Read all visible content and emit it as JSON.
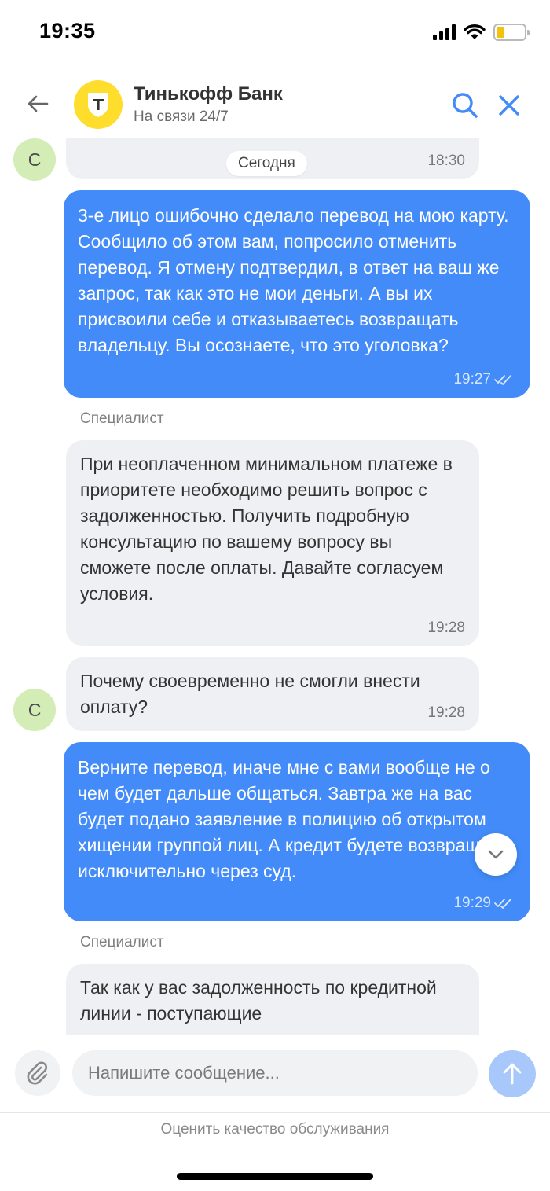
{
  "status_bar": {
    "time": "19:35",
    "icons": [
      "signal-icon",
      "wifi-icon",
      "battery-icon"
    ],
    "battery_color": "#f4c20d"
  },
  "header": {
    "title": "Тинькофф Банк",
    "subtitle": "На связи 24/7",
    "logo_letter": "т",
    "accent_color": "#428bf9"
  },
  "chat": {
    "avatar_letter": "С",
    "sender_label": "Специалист",
    "date_chip": "Сегодня",
    "messages": [
      {
        "direction": "incoming",
        "text": "",
        "time": "18:30"
      },
      {
        "direction": "outgoing",
        "text": "3-е лицо ошибочно сделало перевод на мою карту. Сообщило об этом вам, попросило отменить перевод. Я отмену подтвердил, в ответ на ваш же запрос, так как это не мои деньги. А вы их присвоили себе и отказываетесь возвращать владельцу. Вы осознаете, что это уголовка?",
        "time": "19:27",
        "status": "read"
      },
      {
        "direction": "incoming",
        "sender": "Специалист",
        "text": "При неоплаченном минимальном платеже в приоритете необходимо решить вопрос с задолженностью. Получить подробную консультацию по вашему вопросу вы сможете после оплаты. Давайте согласуем условия.",
        "time": "19:28"
      },
      {
        "direction": "incoming",
        "text": "Почему своевременно не смогли внести оплату?",
        "time": "19:28"
      },
      {
        "direction": "outgoing",
        "text": "Верните перевод, иначе мне с вами вообще не о чем будет дальше общаться. Завтра же на вас будет подано заявление в полицию об открытом хищении группой лиц. А кредит будете возвращать исключительно через суд.",
        "time": "19:29",
        "status": "read"
      },
      {
        "direction": "incoming",
        "sender": "Специалист",
        "text": "Так как у вас задолженность по кредитной линии - поступающие",
        "time": ""
      }
    ]
  },
  "composer": {
    "placeholder": "Напишите сообщение...",
    "value": ""
  },
  "footer": {
    "rate_link": "Оценить качество обслуживания"
  }
}
